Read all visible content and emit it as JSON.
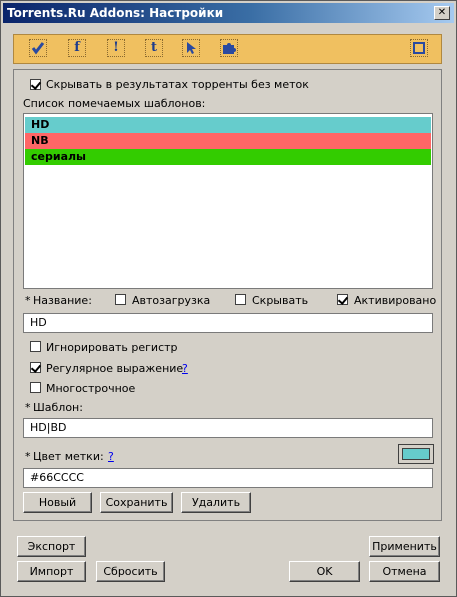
{
  "window": {
    "title": "Torrents.Ru Addons: Настройки",
    "close_glyph": "✕"
  },
  "toolbar": {
    "items": [
      {
        "icon": "checkmark-icon",
        "label": ""
      },
      {
        "icon": "f-icon",
        "label": "f"
      },
      {
        "icon": "exclamation-icon",
        "label": "!"
      },
      {
        "icon": "t-icon",
        "label": "t"
      },
      {
        "icon": "cursor-icon",
        "label": ""
      },
      {
        "icon": "puzzle-icon",
        "label": ""
      },
      {
        "icon": "window-icon",
        "label": ""
      }
    ]
  },
  "options": {
    "hide_untagged_label": "Скрывать в результатах торренты без меток",
    "hide_untagged_checked": true
  },
  "templates": {
    "list_label": "Список помечаемых шаблонов:",
    "items": [
      {
        "label": "HD",
        "color": "#66cccc"
      },
      {
        "label": "NB",
        "color": "#ff6666"
      },
      {
        "label": "сериалы",
        "color": "#33cc00"
      }
    ]
  },
  "form": {
    "name_label": "Название:",
    "required_mark": "*",
    "autoload_label": "Автозагрузка",
    "autoload_checked": false,
    "hide_label": "Скрывать",
    "hide_checked": false,
    "activated_label": "Активировано",
    "activated_checked": true,
    "name_value": "HD",
    "ignore_case_label": "Игнорировать регистр",
    "ignore_case_checked": false,
    "regex_label": "Регулярное выражение",
    "regex_checked": true,
    "help": "?",
    "multiline_label": "Многострочное",
    "multiline_checked": false,
    "pattern_label": "Шаблон:",
    "pattern_value": "HD|BD",
    "color_label": "Цвет метки:",
    "color_value": "#66CCCC",
    "swatch_color": "#66cccc"
  },
  "buttons": {
    "new": "Новый",
    "save": "Сохранить",
    "delete": "Удалить",
    "export": "Экспорт",
    "import": "Импорт",
    "reset": "Сбросить",
    "apply": "Применить",
    "ok": "OK",
    "cancel": "Отмена"
  }
}
